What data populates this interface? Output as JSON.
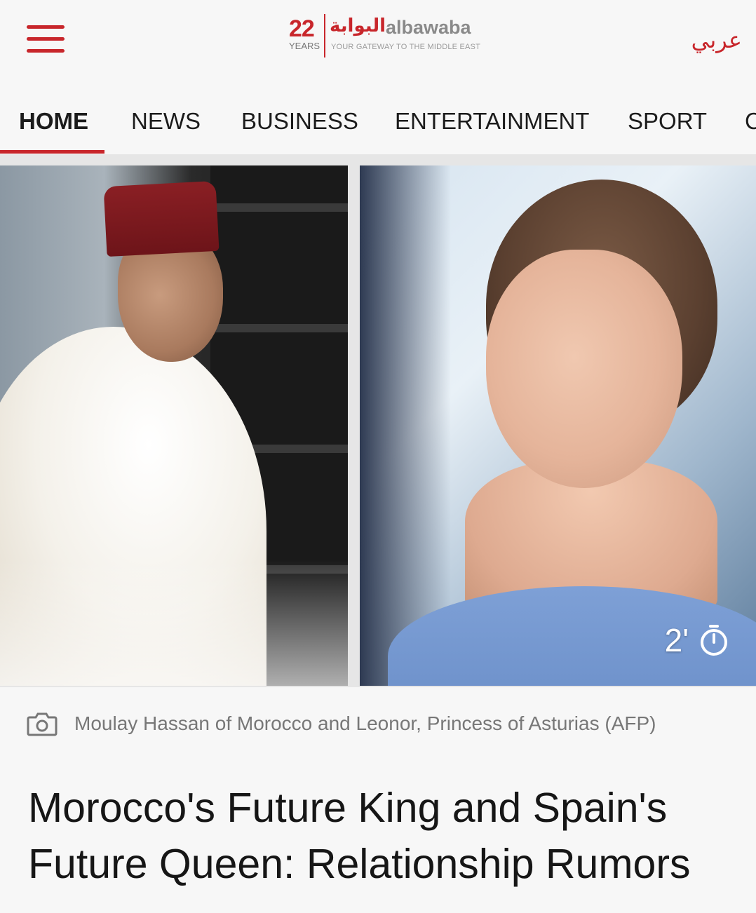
{
  "header": {
    "logo": {
      "years_number": "22",
      "years_label": "YEARS",
      "arabic_name": "البوابة",
      "latin_name": "albawaba",
      "tagline": "YOUR GATEWAY TO THE MIDDLE EAST"
    },
    "language_link": "عربي",
    "menu_icon": "hamburger-menu-icon"
  },
  "nav": {
    "items": [
      {
        "label": "HOME",
        "active": true
      },
      {
        "label": "NEWS",
        "active": false
      },
      {
        "label": "BUSINESS",
        "active": false
      },
      {
        "label": "ENTERTAINMENT",
        "active": false
      },
      {
        "label": "SPORT",
        "active": false
      },
      {
        "label": "C",
        "active": false
      }
    ]
  },
  "article": {
    "read_time": "2'",
    "read_time_icon": "stopwatch-icon",
    "photo_caption": "Moulay Hassan of Morocco and Leonor, Princess of Asturias (AFP)",
    "caption_icon": "camera-icon",
    "headline": "Morocco's Future King and Spain's Future Queen: Relationship Rumors"
  },
  "colors": {
    "accent": "#c8262b",
    "background": "#f7f7f7",
    "caption_text": "#777777",
    "headline_text": "#161616"
  }
}
